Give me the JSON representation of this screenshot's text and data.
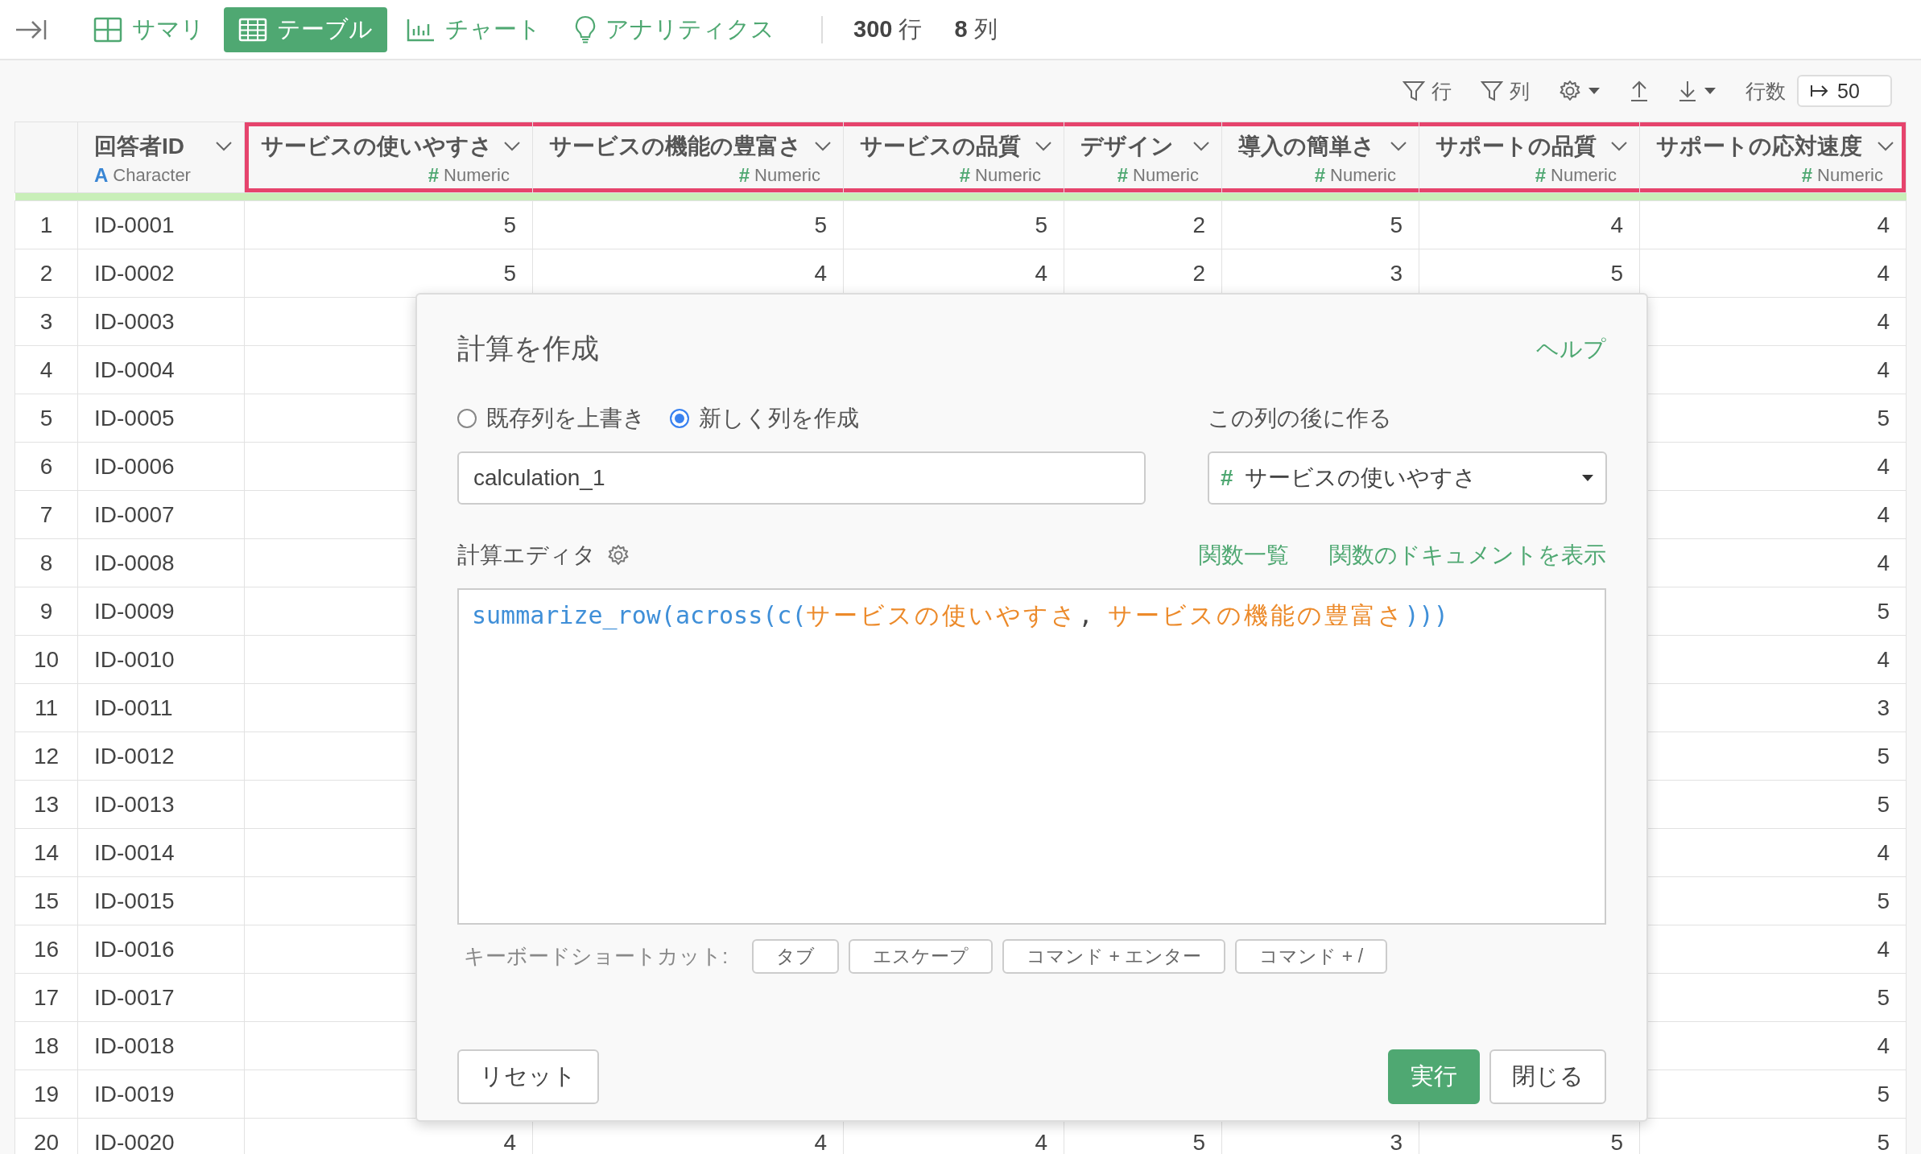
{
  "topbar": {
    "tabs": [
      {
        "kind": "summary",
        "label": "サマリ",
        "selected": false
      },
      {
        "kind": "table",
        "label": "テーブル",
        "selected": true
      },
      {
        "kind": "chart",
        "label": "チャート",
        "selected": false
      },
      {
        "kind": "analytics",
        "label": "アナリティクス",
        "selected": false
      }
    ],
    "counts": [
      "**300** 行",
      "**8** 列"
    ]
  },
  "toolbar": {
    "row_filter": "行",
    "column_filter": "列",
    "row_count_label": "行数",
    "row_count_value": "50"
  },
  "table": {
    "columns": [
      {
        "title": "回答者ID",
        "kind": "character",
        "type_icon": "A",
        "type": "Character",
        "highlighted": false
      },
      {
        "title": "サービスの使いやすさ",
        "kind": "numeric",
        "type_icon": "#",
        "type": "Numeric",
        "highlighted": true
      },
      {
        "title": "サービスの機能の豊富さ",
        "kind": "numeric",
        "type_icon": "#",
        "type": "Numeric",
        "highlighted": true
      },
      {
        "title": "サービスの品質",
        "kind": "numeric",
        "type_icon": "#",
        "type": "Numeric",
        "highlighted": true
      },
      {
        "title": "デザイン",
        "kind": "numeric",
        "type_icon": "#",
        "type": "Numeric",
        "highlighted": true
      },
      {
        "title": "導入の簡単さ",
        "kind": "numeric",
        "type_icon": "#",
        "type": "Numeric",
        "highlighted": true
      },
      {
        "title": "サポートの品質",
        "kind": "numeric",
        "type_icon": "#",
        "type": "Numeric",
        "highlighted": true
      },
      {
        "title": "サポートの応対速度",
        "kind": "numeric",
        "type_icon": "#",
        "type": "Numeric",
        "highlighted": true
      }
    ],
    "rows": [
      {
        "number": "1",
        "id": "ID-0001",
        "values": [
          "5",
          "5",
          "5",
          "2",
          "5",
          "4",
          "4"
        ]
      },
      {
        "number": "2",
        "id": "ID-0002",
        "values": [
          "5",
          "4",
          "4",
          "2",
          "3",
          "5",
          "4"
        ]
      },
      {
        "number": "3",
        "id": "ID-0003",
        "last_value": "4"
      },
      {
        "number": "4",
        "id": "ID-0004",
        "last_value": "4"
      },
      {
        "number": "5",
        "id": "ID-0005",
        "last_value": "5"
      },
      {
        "number": "6",
        "id": "ID-0006",
        "last_value": "4"
      },
      {
        "number": "7",
        "id": "ID-0007",
        "last_value": "4"
      },
      {
        "number": "8",
        "id": "ID-0008",
        "last_value": "4"
      },
      {
        "number": "9",
        "id": "ID-0009",
        "last_value": "5"
      },
      {
        "number": "10",
        "id": "ID-0010",
        "last_value": "4"
      },
      {
        "number": "11",
        "id": "ID-0011",
        "last_value": "3"
      },
      {
        "number": "12",
        "id": "ID-0012",
        "last_value": "5"
      },
      {
        "number": "13",
        "id": "ID-0013",
        "last_value": "5"
      },
      {
        "number": "14",
        "id": "ID-0014",
        "last_value": "4"
      },
      {
        "number": "15",
        "id": "ID-0015",
        "last_value": "5"
      },
      {
        "number": "16",
        "id": "ID-0016",
        "last_value": "4"
      },
      {
        "number": "17",
        "id": "ID-0017",
        "last_value": "5"
      },
      {
        "number": "18",
        "id": "ID-0018",
        "last_value": "4"
      },
      {
        "number": "19",
        "id": "ID-0019",
        "last_value": "5"
      },
      {
        "number": "20",
        "id": "ID-0020",
        "values": [
          "4",
          "4",
          "4",
          "5",
          "3",
          "5",
          "5"
        ]
      }
    ]
  },
  "dialog": {
    "title": "計算を作成",
    "help": "ヘルプ",
    "modes": [
      {
        "label": "既存列を上書き",
        "selected": false
      },
      {
        "label": "新しく列を作成",
        "selected": true
      }
    ],
    "name_value": "calculation_1",
    "after_label": "この列の後に作る",
    "after_icon": "#",
    "after_value": "サービスの使いやすさ",
    "editor_label": "計算エディタ",
    "links": [
      "関数一覧",
      "関数のドキュメントを表示"
    ],
    "formula": [
      {
        "kind": "function",
        "text": "summarize_row"
      },
      {
        "kind": "paren",
        "text": "("
      },
      {
        "kind": "function",
        "text": "across"
      },
      {
        "kind": "paren",
        "text": "("
      },
      {
        "kind": "function",
        "text": "c"
      },
      {
        "kind": "paren",
        "text": "("
      },
      {
        "kind": "column",
        "text": "サービスの使いやすさ"
      },
      {
        "kind": "comma",
        "text": ", "
      },
      {
        "kind": "column",
        "text": "サービスの機能の豊富さ"
      },
      {
        "kind": "paren",
        "text": ")))"
      }
    ],
    "shortcut_label": "キーボードショートカット:",
    "shortcuts": [
      "タブ",
      "エスケープ",
      "コマンド + エンター",
      "コマンド + /"
    ],
    "reset": "リセット",
    "run": "実行",
    "close": "閉じる"
  }
}
